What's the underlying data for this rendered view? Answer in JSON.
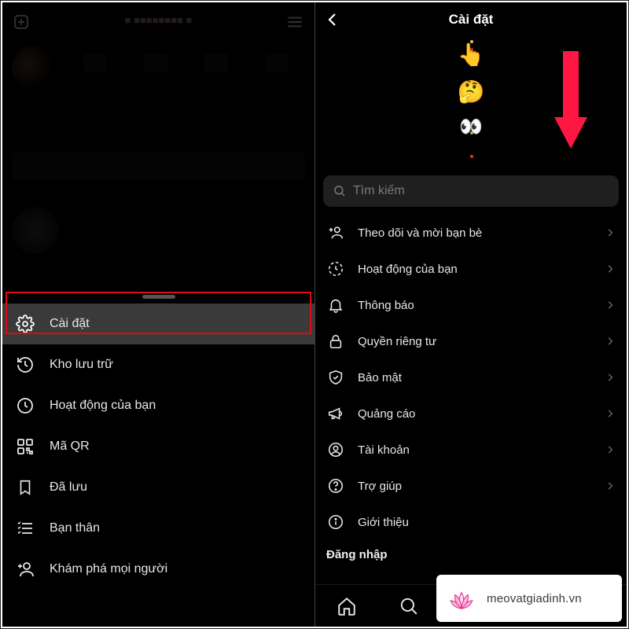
{
  "left": {
    "sheet": {
      "settings": "Cài đặt",
      "archive": "Kho lưu trữ",
      "activity": "Hoạt động của bạn",
      "qr": "Mã QR",
      "saved": "Đã lưu",
      "close_friends": "Bạn thân",
      "discover": "Khám phá mọi người"
    }
  },
  "right": {
    "title": "Cài đặt",
    "search_placeholder": "Tìm kiếm",
    "items": {
      "follow_invite": "Theo dõi và mời bạn bè",
      "your_activity": "Hoạt động của bạn",
      "notifications": "Thông báo",
      "privacy": "Quyền riêng tư",
      "security": "Bảo mật",
      "ads": "Quảng cáo",
      "account": "Tài khoản",
      "help": "Trợ giúp",
      "about": "Giới thiệu"
    },
    "login_header": "Đăng nhập"
  },
  "watermark": "meovatgiadinh.vn",
  "emojis": {
    "point": "👆",
    "think": "🤔",
    "eyes": "👀"
  }
}
